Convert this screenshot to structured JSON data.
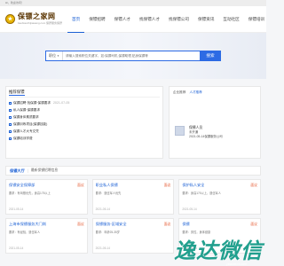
{
  "topbar": {
    "text": "Hi，欢迎访问！"
  },
  "header": {
    "logo_title": "保镖之家网",
    "logo_sub": "baobiaozhijiawang.com 保镖服务保镖",
    "nav": [
      {
        "label": "首页",
        "active": true
      },
      {
        "label": "保镖招聘",
        "active": false
      },
      {
        "label": "保镖人才",
        "active": false
      },
      {
        "label": "找保镖人才",
        "active": false
      },
      {
        "label": "找保镖公司",
        "active": false
      },
      {
        "label": "保镖资讯",
        "active": false
      },
      {
        "label": "互动社区",
        "active": false
      },
      {
        "label": "保镖培训",
        "active": false
      }
    ]
  },
  "search": {
    "type_label": "职位",
    "placeholder": "请输入搜索职位关键字，如:保镖司机,保镖助理,贴身保镖等",
    "button_label": "搜索"
  },
  "news": {
    "title": "推荐保镖",
    "items": [
      {
        "text": "保镖招聘·找保镖·保镖要求",
        "date": "2021-07-05"
      },
      {
        "text": "私人保镖·保镖要求",
        "date": ""
      },
      {
        "text": "保镖身体素质要求",
        "date": ""
      },
      {
        "text": "保镖训练项目(保镖技能)",
        "date": ""
      },
      {
        "text": "保镖人才大专文凭",
        "date": ""
      },
      {
        "text": "保镖培训学费",
        "date": ""
      }
    ]
  },
  "side": {
    "tabs": [
      "企业推荐",
      "人才推荐"
    ],
    "active_tab": 1,
    "name": "保镖人员",
    "info": "未开通",
    "date": "2021-05-14保镖服务公司"
  },
  "hall": {
    "title": "保镖大厅",
    "desc": "最新保镖招聘信息"
  },
  "cards": [
    {
      "title": "保镖安全保障部",
      "salary": "面议",
      "line1": "要求：有驾照优先，身高175以上",
      "foot": "2021-05-14"
    },
    {
      "title": "职业私人保镖",
      "salary": "面议",
      "line1": "要求：退伍军人优先",
      "foot": "2021-05-14"
    },
    {
      "title": "保护私人安全",
      "salary": "面议",
      "line1": "要求：身高175以上，退伍军人",
      "foot": "2021-05-14"
    },
    {
      "title": "上海市保镖服务大门岗",
      "salary": "面议",
      "line1": "要求：有经验，退伍军人",
      "foot": "2021-05-14"
    },
    {
      "title": "保镖服务-区域安全",
      "salary": "面议",
      "line1": "要求：年龄25-35岁",
      "foot": "2021-05-14"
    },
    {
      "title": "保镖",
      "salary": "面议",
      "line1": "要求：男性，身体健康",
      "foot": "2021-05-14"
    }
  ],
  "watermark": {
    "text": "逸达微信",
    "url": "yidaweixin.com"
  }
}
